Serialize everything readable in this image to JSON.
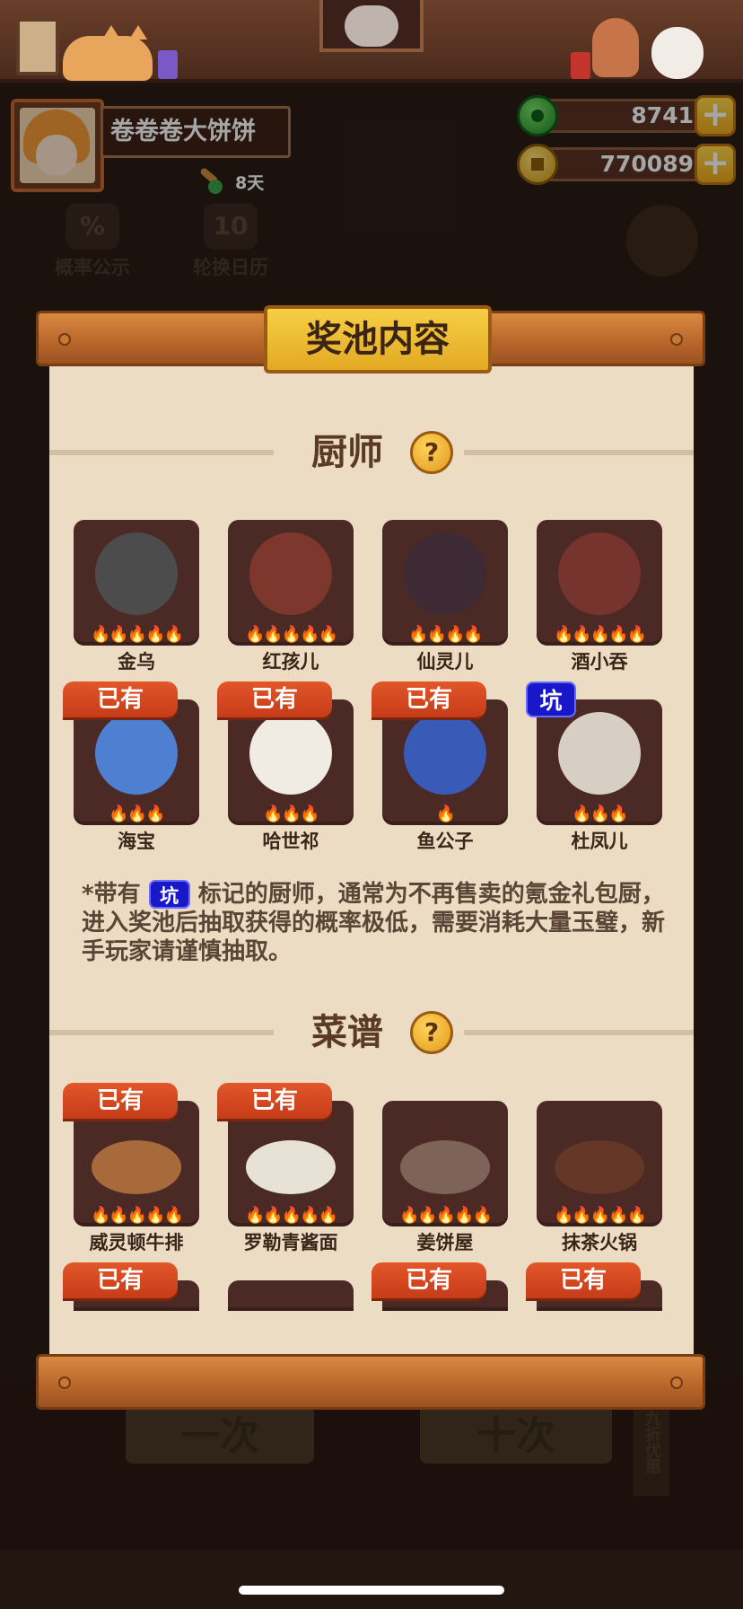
{
  "player": {
    "name": "卷卷卷大饼饼",
    "stamina_text": "8天"
  },
  "currency": {
    "jade": "8741",
    "coins": "770089",
    "plus": "+"
  },
  "background": {
    "rate_button": "概率公示",
    "rate_icon": "%",
    "calendar_button": "轮换日历",
    "calendar_icon": "10",
    "bottom_left_button": "一次",
    "bottom_right_button": "十次",
    "side_sign": "九折优惠"
  },
  "dialog": {
    "title": "奖池内容",
    "chef_section_title": "厨师",
    "recipe_section_title": "菜谱",
    "help_symbol": "?",
    "own_label": "已有",
    "pit_label": "坑",
    "note_prefix": "*带有",
    "note_suffix": "标记的厨师，通常为不再售卖的氪金礼包厨，进入奖池后抽取获得的概率极低，需要消耗大量玉璧，新手玩家请谨慎抽取。",
    "chefs": [
      {
        "name": "金乌",
        "stars": 5,
        "owned": false,
        "pit": false,
        "color": "#4f7f8a"
      },
      {
        "name": "红孩儿",
        "stars": 5,
        "owned": false,
        "pit": false,
        "color": "#c84a3a"
      },
      {
        "name": "仙灵儿",
        "stars": 4,
        "owned": false,
        "pit": false,
        "color": "#2a2a4a"
      },
      {
        "name": "酒小吞",
        "stars": 5,
        "owned": false,
        "pit": false,
        "color": "#b8403a"
      },
      {
        "name": "海宝",
        "stars": 3,
        "owned": true,
        "pit": false,
        "color": "#4f7fd0"
      },
      {
        "name": "哈世祁",
        "stars": 3,
        "owned": true,
        "pit": false,
        "color": "#f0ece4"
      },
      {
        "name": "鱼公子",
        "stars": 1,
        "owned": true,
        "pit": false,
        "color": "#3a5ab8"
      },
      {
        "name": "杜凤儿",
        "stars": 3,
        "owned": false,
        "pit": true,
        "color": "#d8cfc4"
      }
    ],
    "recipes": [
      {
        "name": "威灵顿牛排",
        "stars": 5,
        "owned": true,
        "color": "#a86a3a"
      },
      {
        "name": "罗勒青酱面",
        "stars": 5,
        "owned": true,
        "color": "#e8e2d6"
      },
      {
        "name": "姜饼屋",
        "stars": 5,
        "owned": false,
        "color": "#c8b8a4"
      },
      {
        "name": "抹茶火锅",
        "stars": 5,
        "owned": false,
        "color": "#8a4a2a"
      }
    ],
    "recipes_partial": [
      {
        "owned": true
      },
      {
        "owned": false
      },
      {
        "owned": true
      },
      {
        "owned": true
      }
    ]
  }
}
